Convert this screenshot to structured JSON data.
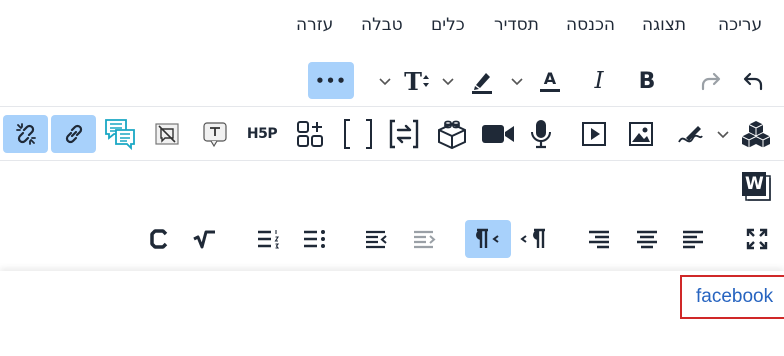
{
  "menubar": {
    "items": [
      "עריכה",
      "תצוגה",
      "הכנסה",
      "תסדיר",
      "כלים",
      "טבלה",
      "עזרה"
    ]
  },
  "toolbar1": {
    "bold_label": "B",
    "italic_label": "I",
    "text_color_label": "A",
    "font_size_label": "T",
    "more_label": "•••"
  },
  "toolbar2": {
    "h5p_label": "H5P"
  },
  "word_icon_label": "W",
  "content": {
    "link_text": "facebook"
  },
  "colors": {
    "active_bg": "#a8d1fb",
    "icon": "#1f2937",
    "link": "#2764c0",
    "highlight_border": "#d02828",
    "speech_bubble": "#1aa7c4"
  }
}
